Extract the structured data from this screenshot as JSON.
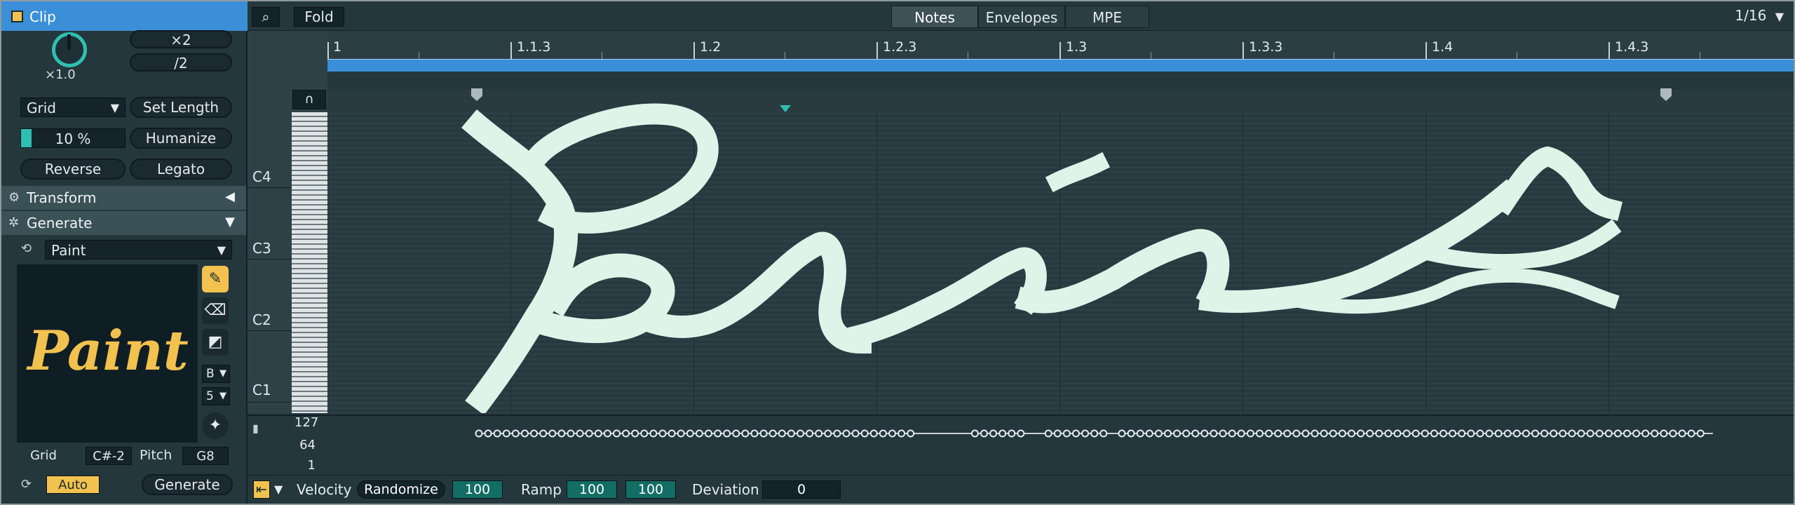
{
  "clip": {
    "title": "Clip",
    "speed_knob_value": "×1.0",
    "double_label": "×2",
    "half_label": "/2",
    "grid_dropdown": "Grid",
    "set_length_label": "Set Length",
    "humanize_amount": "10 %",
    "humanize_level": 0.1,
    "humanize_label": "Humanize",
    "reverse_label": "Reverse",
    "legato_label": "Legato"
  },
  "sections": {
    "transform_label": "Transform",
    "generate_label": "Generate"
  },
  "generator": {
    "selected": "Paint",
    "preview_text": "Paint",
    "brush_shape": "B",
    "brush_size": "5",
    "grid_label": "Grid",
    "low_pitch": "C#-2",
    "pitch_label": "Pitch",
    "high_pitch": "G8",
    "auto_label": "Auto",
    "generate_button": "Generate"
  },
  "toolbar": {
    "fold_label": "Fold",
    "tabs": [
      "Notes",
      "Envelopes",
      "MPE"
    ],
    "active_tab": "Notes",
    "grid_value": "1/16"
  },
  "ruler": {
    "labels": [
      "1",
      "1.1.3",
      "1.2",
      "1.2.3",
      "1.3",
      "1.3.3",
      "1.4",
      "1.4.3"
    ]
  },
  "keyboard": {
    "octaves": [
      "C4",
      "C3",
      "C2",
      "C1"
    ]
  },
  "velocity_lane": {
    "scale": [
      "127",
      "64",
      "1"
    ]
  },
  "bottom": {
    "velocity_label": "Velocity",
    "randomize_label": "Randomize",
    "randomize_value": "100",
    "ramp_label": "Ramp",
    "ramp_start": "100",
    "ramp_end": "100",
    "deviation_label": "Deviation",
    "deviation_value": "0"
  },
  "icons": {
    "pencil": "pencil-icon",
    "eraser": "eraser-icon",
    "fill": "fill-bucket-icon",
    "sparkle": "sparkle-icon",
    "search": "search-icon",
    "loop": "loop-icon"
  },
  "colors": {
    "accent_blue": "#3a8fd8",
    "accent_yellow": "#f2c14e",
    "accent_teal": "#2fbfb1",
    "note_fill": "#ddf5e8"
  }
}
